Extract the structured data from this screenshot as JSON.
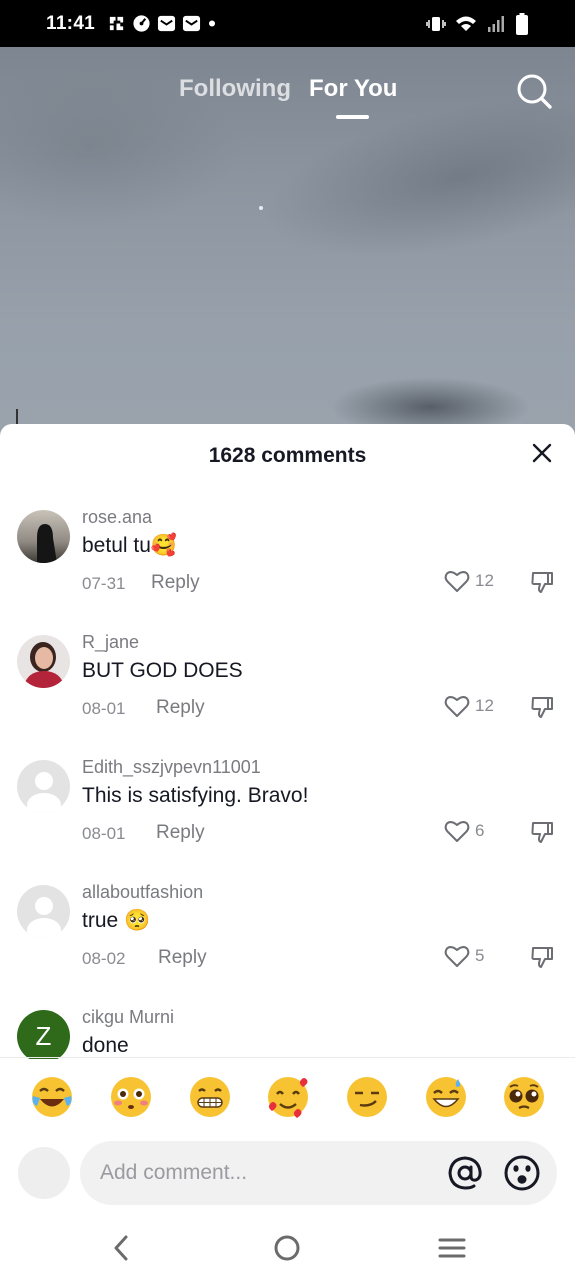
{
  "status": {
    "time": "11:41",
    "left_icons": [
      "scan-icon",
      "speed-icon",
      "mail-icon",
      "mail-icon",
      "dot-icon"
    ],
    "right_icons": [
      "vibrate-icon",
      "wifi-icon",
      "signal-icon",
      "battery-icon"
    ]
  },
  "feed": {
    "tab_following": "Following",
    "tab_for_you": "For You",
    "active_tab": "For You"
  },
  "comments_panel": {
    "title": "1628 comments",
    "comments": [
      {
        "user": "rose.ana",
        "text": "betul tu🥰",
        "date": "07-31",
        "reply": "Reply",
        "likes": "12",
        "avatar": "photo-veiled"
      },
      {
        "user": "R_jane",
        "text": "BUT GOD DOES",
        "date": "08-01",
        "reply": "Reply",
        "likes": "12",
        "avatar": "photo-woman"
      },
      {
        "user": "Edith_sszjvpevn11001",
        "text": "This is satisfying. Bravo!",
        "date": "08-01",
        "reply": "Reply",
        "likes": "6",
        "avatar": "default"
      },
      {
        "user": "allaboutfashion",
        "text": "true 🥺",
        "date": "08-02",
        "reply": "Reply",
        "likes": "5",
        "avatar": "default"
      },
      {
        "user": "cikgu Murni",
        "text": "done",
        "date": "",
        "reply": "",
        "likes": "",
        "avatar": "letter",
        "avatar_letter": "Z"
      }
    ],
    "quick_emojis": [
      "😂",
      "😳",
      "😁",
      "🥰",
      "😏",
      "😅",
      "🥺"
    ],
    "input_placeholder": "Add comment...",
    "colors": {
      "accent_text": "#161823",
      "secondary": "#8a8b91",
      "z_avatar": "#2e6a1a"
    }
  },
  "nav": {
    "icons": [
      "back-icon",
      "home-icon",
      "recents-icon"
    ]
  }
}
